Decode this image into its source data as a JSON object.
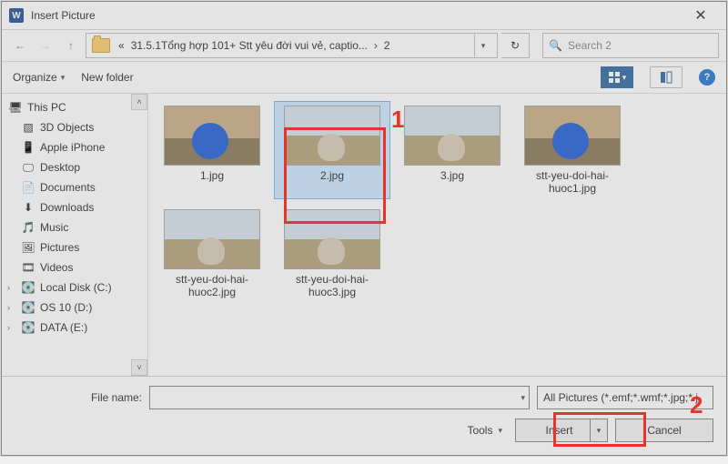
{
  "title": "Insert Picture",
  "nav": {
    "path_prefix": "«",
    "path_1": "31.5.1Tổng hợp 101+ Stt yêu đời vui vẻ, captio...",
    "path_sep": "›",
    "path_2": "2"
  },
  "search": {
    "placeholder": "Search 2"
  },
  "toolbar": {
    "organize": "Organize",
    "new_folder": "New folder"
  },
  "sidebar": {
    "items": [
      {
        "label": "This PC",
        "icon": "pc",
        "root": true,
        "chev": "down"
      },
      {
        "label": "3D Objects",
        "icon": "3d"
      },
      {
        "label": "Apple iPhone",
        "icon": "phone"
      },
      {
        "label": "Desktop",
        "icon": "desktop"
      },
      {
        "label": "Documents",
        "icon": "doc"
      },
      {
        "label": "Downloads",
        "icon": "down"
      },
      {
        "label": "Music",
        "icon": "music"
      },
      {
        "label": "Pictures",
        "icon": "pic"
      },
      {
        "label": "Videos",
        "icon": "video"
      },
      {
        "label": "Local Disk (C:)",
        "icon": "disk",
        "chev": "right"
      },
      {
        "label": "OS 10 (D:)",
        "icon": "disk",
        "chev": "right"
      },
      {
        "label": "DATA (E:)",
        "icon": "disk",
        "chev": "right"
      }
    ]
  },
  "files": [
    {
      "name": "1.jpg",
      "art": "blue",
      "selected": false
    },
    {
      "name": "2.jpg",
      "art": "cat",
      "selected": true
    },
    {
      "name": "3.jpg",
      "art": "cat",
      "selected": false
    },
    {
      "name": "stt-yeu-doi-hai-huoc1.jpg",
      "art": "blue",
      "selected": false
    },
    {
      "name": "stt-yeu-doi-hai-huoc2.jpg",
      "art": "cat",
      "selected": false
    },
    {
      "name": "stt-yeu-doi-hai-huoc3.jpg",
      "art": "cat",
      "selected": false
    }
  ],
  "footer": {
    "file_name_label": "File name:",
    "file_name_value": "",
    "filter_label": "All Pictures (*.emf;*.wmf;*.jpg;*.j",
    "tools_label": "Tools",
    "insert_label": "Insert",
    "cancel_label": "Cancel"
  },
  "annotations": {
    "one": "1",
    "two": "2"
  }
}
